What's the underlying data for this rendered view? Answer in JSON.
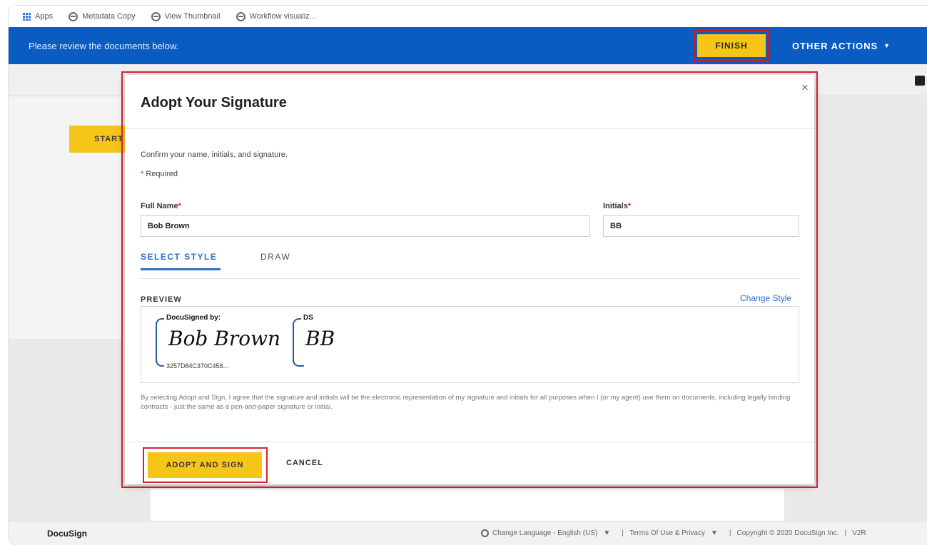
{
  "bookmarks": [
    {
      "label": "Apps",
      "icon": "apps-grid-icon"
    },
    {
      "label": "Metadata Copy",
      "icon": "globe-icon"
    },
    {
      "label": "View Thumbnail",
      "icon": "globe-icon"
    },
    {
      "label": "Workflow visualiz...",
      "icon": "globe-icon"
    }
  ],
  "banner": {
    "message": "Please review the documents below.",
    "finish_label": "FINISH",
    "other_actions_label": "OTHER ACTIONS",
    "other_actions_caret": "▼",
    "color": "#0a5cc2"
  },
  "sidebar": {
    "start_label": "START"
  },
  "modal": {
    "close": "×",
    "title": "Adopt Your Signature",
    "confirm_text": "Confirm your name, initials, and signature.",
    "required_marker": "*",
    "required_text": "Required",
    "full_name_label": "Full Name",
    "full_name_value": "Bob Brown",
    "initials_label": "Initials",
    "initials_value": "BB",
    "tabs": [
      {
        "label": "SELECT STYLE",
        "active": true
      },
      {
        "label": "DRAW",
        "active": false
      }
    ],
    "preview_label": "PREVIEW",
    "change_style_label": "Change Style",
    "signature": {
      "header": "DocuSigned by:",
      "script": "Bob Brown",
      "id": "3257D84C370C458..."
    },
    "initials_preview": {
      "header": "DS",
      "script": "BB"
    },
    "disclaimer": "By selecting Adopt and Sign, I agree that the signature and initials will be the electronic representation of my signature and initials for all purposes when I (or my agent) use them on documents, including legally binding contracts - just the same as a pen-and-paper signature or initial.",
    "adopt_label": "ADOPT AND SIGN",
    "cancel_label": "CANCEL",
    "accent_color": "#f5c518",
    "highlight_color": "#d8232f"
  },
  "footer": {
    "brand": "DocuSign",
    "language": "Change Language - English (US)",
    "language_caret": "▼",
    "separator": "|",
    "terms": "Terms Of Use & Privacy",
    "terms_caret": "▼",
    "copyright": "Copyright © 2020 DocuSign Inc.",
    "version": "V2R"
  }
}
